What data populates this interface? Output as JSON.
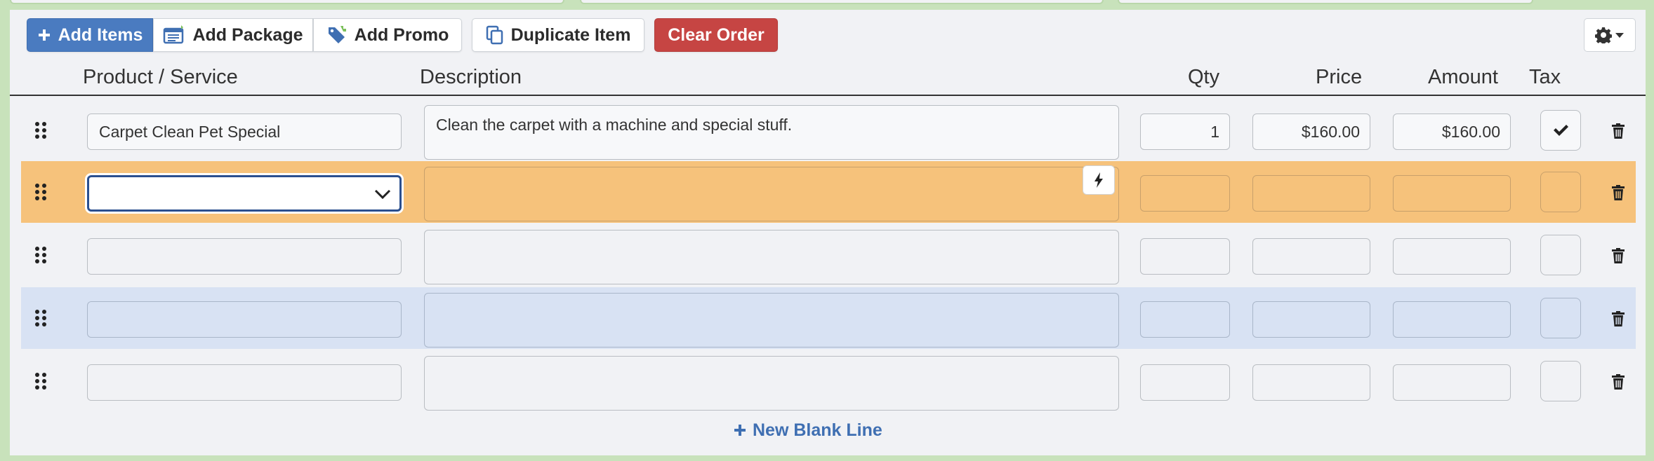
{
  "toolbar": {
    "add_items": "Add Items",
    "add_package": "Add Package",
    "add_promo": "Add Promo",
    "duplicate_item": "Duplicate Item",
    "clear_order": "Clear Order"
  },
  "table": {
    "headers": {
      "product": "Product / Service",
      "description": "Description",
      "qty": "Qty",
      "price": "Price",
      "amount": "Amount",
      "tax": "Tax"
    },
    "rows": [
      {
        "product": "Carpet Clean Pet Special",
        "description": "Clean the carpet with a machine and special stuff.",
        "qty": "1",
        "price": "$160.00",
        "amount": "$160.00",
        "tax": true
      },
      {
        "product": "",
        "description": "",
        "qty": "",
        "price": "",
        "amount": "",
        "tax": false
      },
      {
        "product": "",
        "description": "",
        "qty": "",
        "price": "",
        "amount": "",
        "tax": false
      },
      {
        "product": "",
        "description": "",
        "qty": "",
        "price": "",
        "amount": "",
        "tax": false
      },
      {
        "product": "",
        "description": "",
        "qty": "",
        "price": "",
        "amount": "",
        "tax": false
      }
    ]
  },
  "new_blank_line": "New Blank Line",
  "colors": {
    "primary": "#4a7bc0",
    "danger": "#c64543",
    "highlight_row": "#f6c27b",
    "hover_row": "#d8e2f3",
    "frame": "#c8e2bb"
  }
}
